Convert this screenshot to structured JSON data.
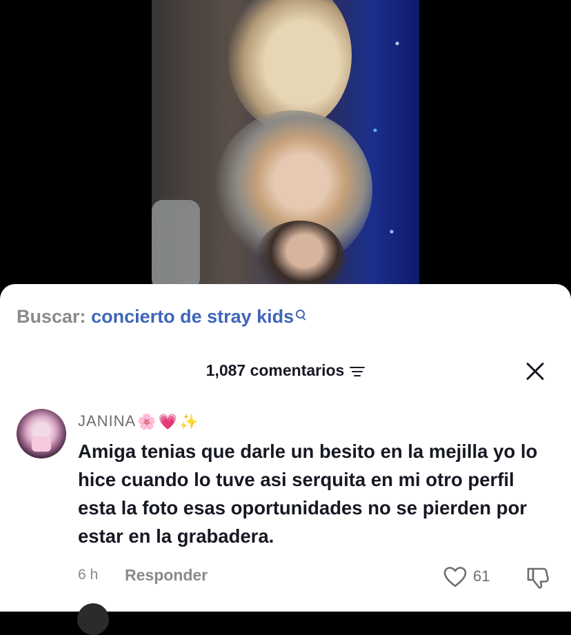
{
  "search": {
    "label": "Buscar:",
    "query": "concierto de stray kids"
  },
  "comments": {
    "count_label": "1,087 comentarios"
  },
  "comment": {
    "username": "JANINA",
    "emojis": [
      "🌸",
      "💗",
      "✨"
    ],
    "text": "Amiga tenias que darle un besito en la mejilla yo lo hice cuando lo tuve asi serquita en mi otro perfil esta la foto esas oportunidades no se pierden por estar en la grabadera.",
    "time": "6 h",
    "reply_label": "Responder",
    "likes": "61"
  },
  "colors": {
    "search_query": "#3f65b8",
    "muted_text": "#8a8a8a",
    "primary_text": "#161823"
  },
  "icons": [
    "search-icon",
    "filter-icon",
    "close-icon",
    "heart-icon",
    "thumbs-down-icon"
  ]
}
